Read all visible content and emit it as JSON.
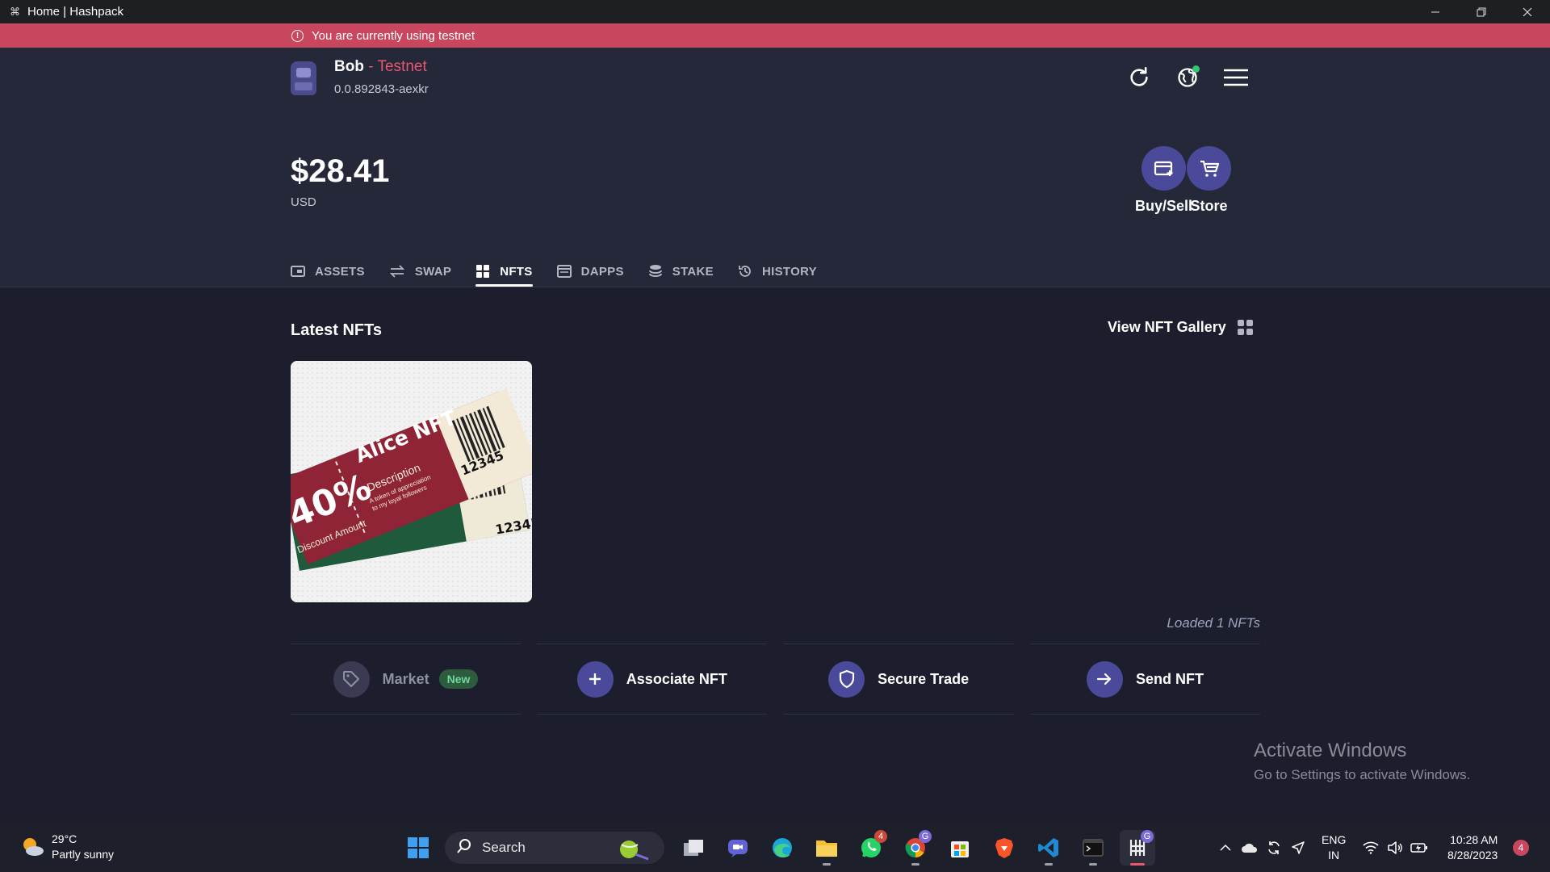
{
  "window": {
    "title": "Home | Hashpack",
    "controls": [
      "minimize",
      "restore",
      "close"
    ]
  },
  "banner": {
    "text": "You are currently using testnet"
  },
  "account": {
    "name": "Bob",
    "separator": " - ",
    "network": "Testnet",
    "id": "0.0.892843-aexkr"
  },
  "header_icons": [
    "refresh-icon",
    "globe-icon",
    "menu-icon"
  ],
  "balance": {
    "amount": "$28.41",
    "currency": "USD"
  },
  "actions": {
    "buy_sell": "Buy/Sell",
    "store": "Store"
  },
  "tabs": [
    {
      "label": "ASSETS",
      "icon": "wallet-icon"
    },
    {
      "label": "SWAP",
      "icon": "swap-icon"
    },
    {
      "label": "NFTS",
      "icon": "grid-icon"
    },
    {
      "label": "DAPPS",
      "icon": "browser-icon"
    },
    {
      "label": "STAKE",
      "icon": "coins-icon"
    },
    {
      "label": "HISTORY",
      "icon": "history-icon"
    }
  ],
  "active_tab": "NFTS",
  "nfts": {
    "title": "Latest NFTs",
    "gallery_link": "View NFT Gallery",
    "loaded_text": "Loaded 1 NFTs",
    "items": [
      {
        "heading": "Alice NFT",
        "subheading": "Description",
        "tagline": "A token of appreciation to my loyal followers",
        "discount": "40%",
        "discount_label": "Discount Amount",
        "serial": "12345"
      }
    ]
  },
  "bottom_actions": [
    {
      "label": "Market",
      "badge": "New",
      "icon": "tag-icon"
    },
    {
      "label": "Associate NFT",
      "icon": "plus-icon"
    },
    {
      "label": "Secure Trade",
      "icon": "shield-icon"
    },
    {
      "label": "Send NFT",
      "icon": "arrow-right-icon"
    }
  ],
  "watermark": {
    "title": "Activate Windows",
    "subtitle": "Go to Settings to activate Windows."
  },
  "taskbar": {
    "weather": {
      "temp": "29°C",
      "condition": "Partly sunny"
    },
    "search_label": "Search",
    "badges": {
      "whatsapp": "4",
      "chrome": "G",
      "hashpack": "G"
    },
    "language": {
      "line1": "ENG",
      "line2": "IN"
    },
    "clock": {
      "time": "10:28 AM",
      "date": "8/28/2023"
    },
    "notifications": "4"
  },
  "colors": {
    "banner": "#c9465f",
    "accent": "#4b4a9a",
    "network": "#e8576e",
    "background": "#1c1e2d",
    "header": "#252839"
  }
}
